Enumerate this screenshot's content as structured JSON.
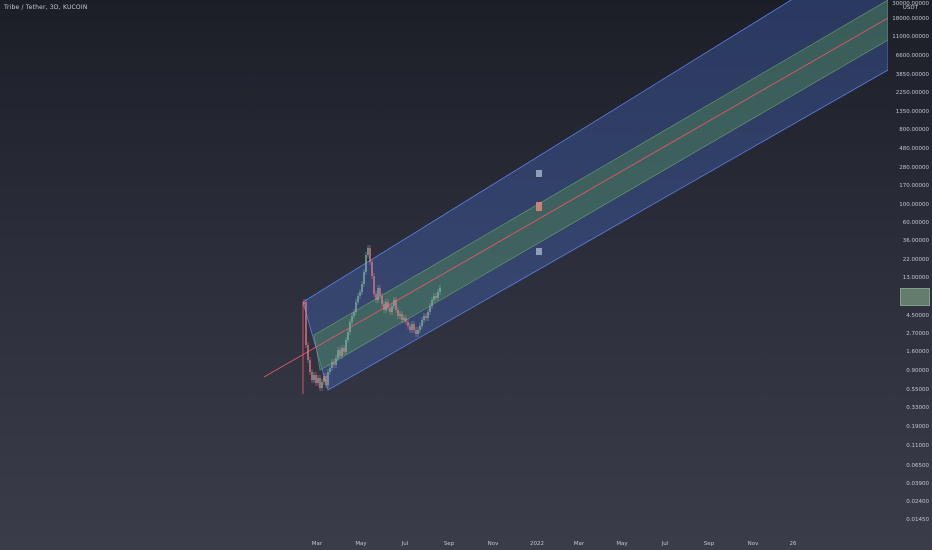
{
  "header": {
    "symbol": "Tribe / Tether, 3D, KUCOIN"
  },
  "price_axis": {
    "currency": "USDT",
    "labels": [
      "30000.00000",
      "18000.00000",
      "11000.00000",
      "6600.00000",
      "3850.00000",
      "2250.00000",
      "1350.00000",
      "800.00000",
      "480.00000",
      "280.00000",
      "170.00000",
      "100.00000",
      "60.00000",
      "36.00000",
      "22.00000",
      "13.00000",
      "4.50000",
      "2.70000",
      "1.60000",
      "0.90000",
      "0.55000",
      "0.33000",
      "0.19000",
      "0.11000",
      "0.06500",
      "0.03900",
      "0.02400",
      "0.01450"
    ]
  },
  "time_axis": {
    "labels": [
      "Mar",
      "May",
      "Jul",
      "Sep",
      "Nov",
      "2022",
      "Mar",
      "May",
      "Jul",
      "Sep",
      "Nov",
      "26"
    ]
  },
  "colors": {
    "outer_band": "#4a6fd6",
    "inner_band": "#5a9a5a",
    "midline": "#e0566b",
    "candle_up": "#7fb3a6",
    "candle_down": "#e07a86"
  }
}
